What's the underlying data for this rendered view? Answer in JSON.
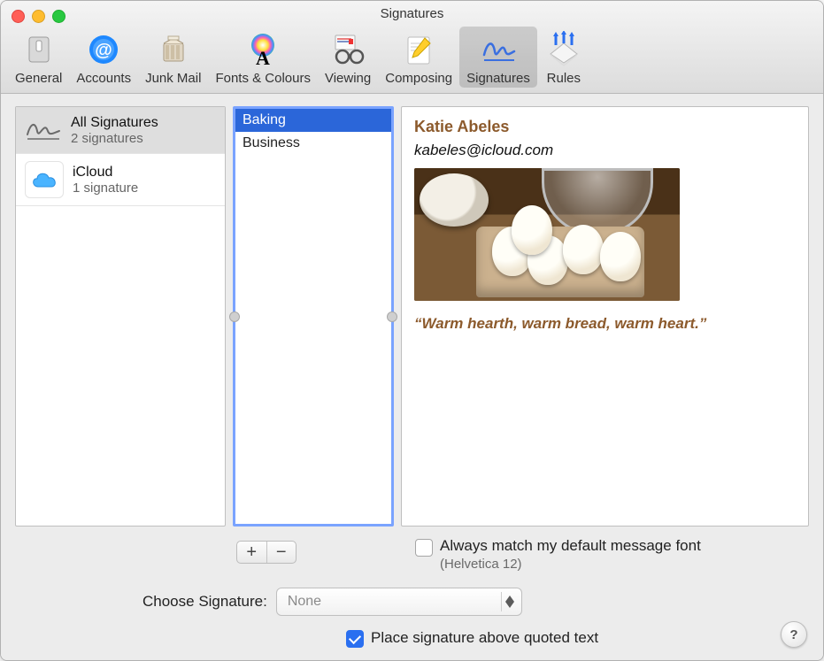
{
  "window": {
    "title": "Signatures"
  },
  "toolbar": {
    "items": [
      {
        "label": "General"
      },
      {
        "label": "Accounts"
      },
      {
        "label": "Junk Mail"
      },
      {
        "label": "Fonts & Colours"
      },
      {
        "label": "Viewing"
      },
      {
        "label": "Composing"
      },
      {
        "label": "Signatures"
      },
      {
        "label": "Rules"
      }
    ],
    "active_index": 6
  },
  "accounts": [
    {
      "title": "All Signatures",
      "subtitle": "2 signatures",
      "icon": "signature",
      "selected": true
    },
    {
      "title": "iCloud",
      "subtitle": "1 signature",
      "icon": "cloud",
      "selected": false
    }
  ],
  "signatures": {
    "items": [
      "Baking",
      "Business"
    ],
    "selected_index": 0,
    "add_label": "+",
    "remove_label": "−"
  },
  "preview": {
    "name": "Katie Abeles",
    "email": "kabeles@icloud.com",
    "quote": "“Warm hearth, warm bread, warm heart.”"
  },
  "options": {
    "match_font_label": "Always match my default message font",
    "match_font_checked": false,
    "font_note": "(Helvetica 12)",
    "choose_label": "Choose Signature:",
    "choose_value": "None",
    "place_above_label": "Place signature above quoted text",
    "place_above_checked": true
  },
  "help_label": "?"
}
